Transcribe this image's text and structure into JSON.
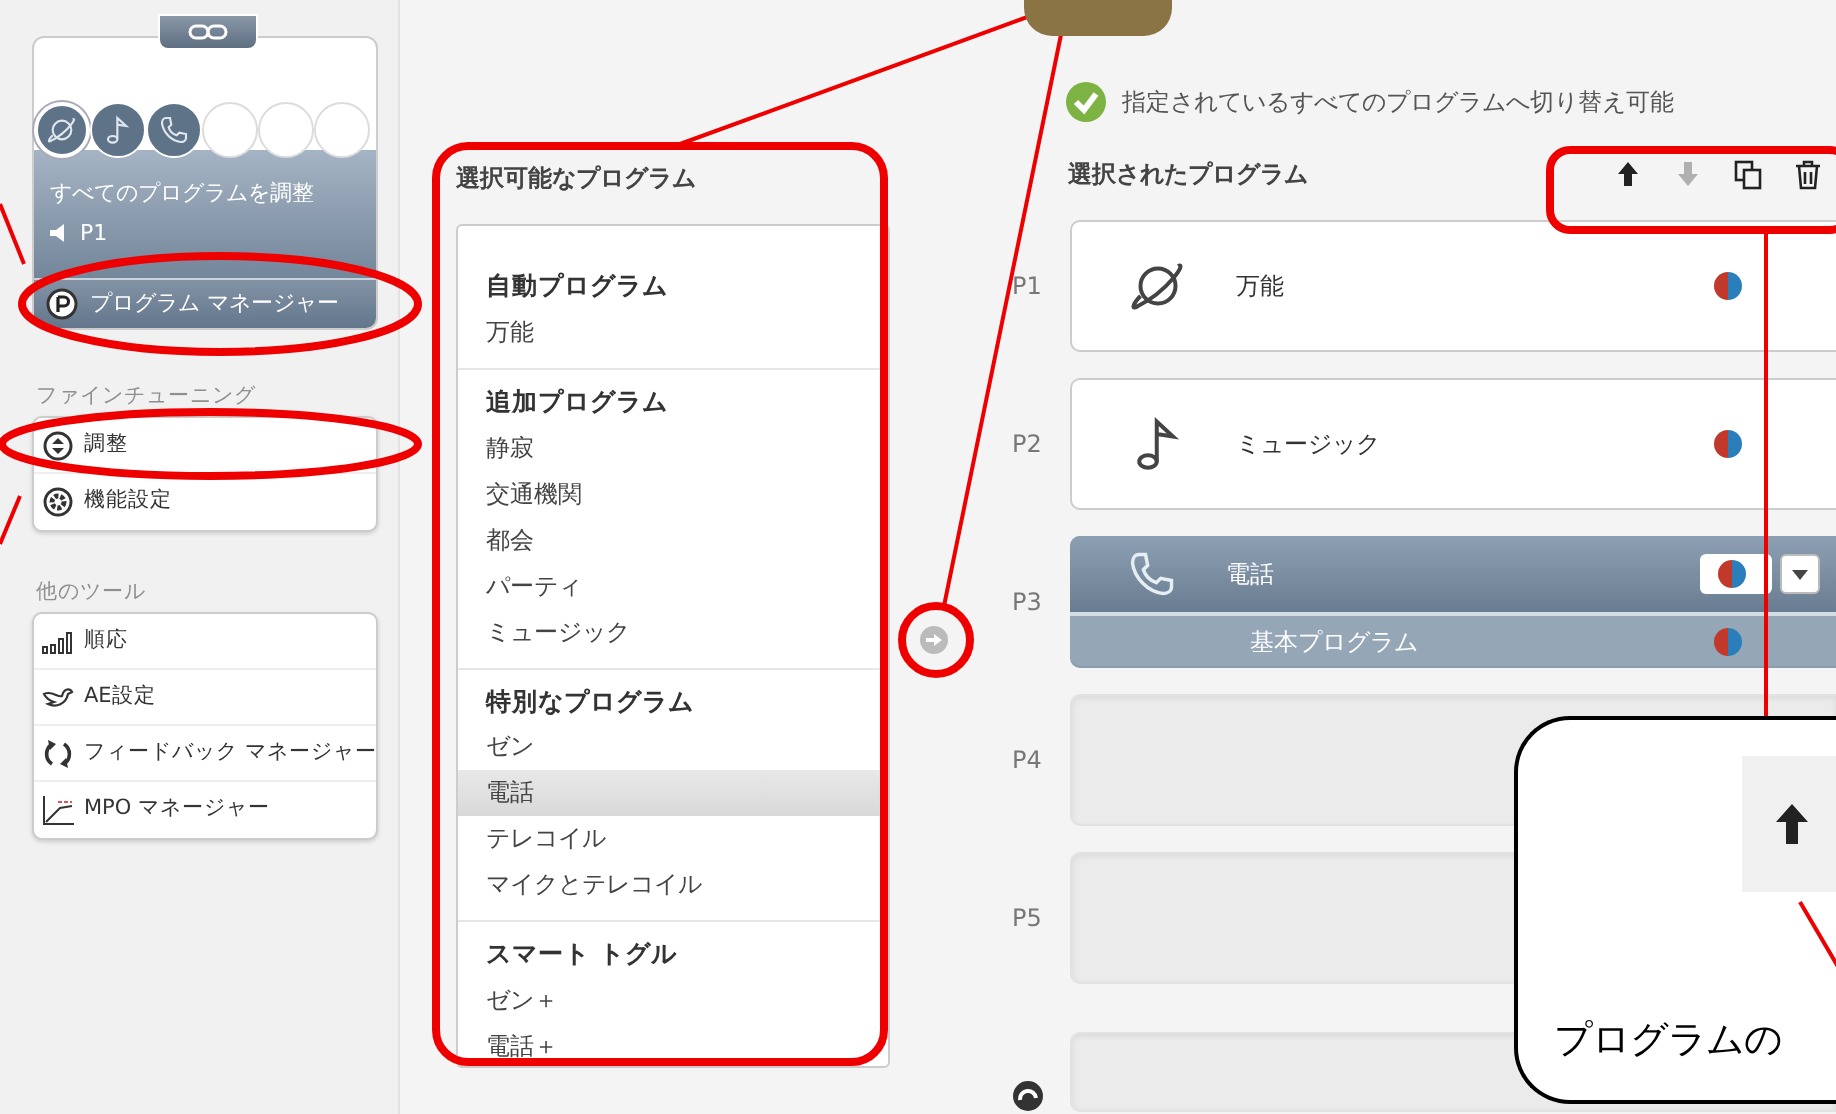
{
  "sidebar": {
    "program_slots": [
      {
        "kind": "planet",
        "selected": true
      },
      {
        "kind": "note",
        "selected": false
      },
      {
        "kind": "phone",
        "selected": false
      },
      {
        "kind": "empty",
        "selected": false
      },
      {
        "kind": "empty",
        "selected": false
      },
      {
        "kind": "empty",
        "selected": false
      }
    ],
    "current": {
      "title": "すべてのプログラムを調整",
      "program": "P1"
    },
    "nav": [
      {
        "label": "プログラム マネージャー",
        "kind": "programs",
        "selected": true
      }
    ],
    "sections": [
      {
        "title": "ファインチューニング",
        "items": [
          {
            "label": "調整",
            "kind": "adjust"
          },
          {
            "label": "機能設定",
            "kind": "gear"
          }
        ]
      },
      {
        "title": "他のツール",
        "items": [
          {
            "label": "順応",
            "kind": "bars"
          },
          {
            "label": "AE設定",
            "kind": "bird"
          },
          {
            "label": "フィードバック マネージャー",
            "kind": "cycle"
          },
          {
            "label": "MPO マネージャー",
            "kind": "curve"
          }
        ]
      }
    ]
  },
  "available": {
    "title": "選択可能なプログラム",
    "groups": [
      {
        "heading": "自動プログラム",
        "items": [
          {
            "label": "万能",
            "selected": false
          }
        ]
      },
      {
        "heading": "追加プログラム",
        "items": [
          {
            "label": "静寂",
            "selected": false
          },
          {
            "label": "交通機関",
            "selected": false
          },
          {
            "label": "都会",
            "selected": false
          },
          {
            "label": "パーティ",
            "selected": false
          },
          {
            "label": "ミュージック",
            "selected": false
          }
        ]
      },
      {
        "heading": "特別なプログラム",
        "items": [
          {
            "label": "ゼン",
            "selected": false
          },
          {
            "label": "電話",
            "selected": true
          },
          {
            "label": "テレコイル",
            "selected": false
          },
          {
            "label": "マイクとテレコイル",
            "selected": false
          }
        ]
      },
      {
        "heading": "スマート トグル",
        "items": [
          {
            "label": "ゼン＋",
            "selected": false
          },
          {
            "label": "電話＋",
            "selected": false
          }
        ]
      }
    ]
  },
  "status": {
    "text": "指定されているすべてのプログラムへ切り替え可能"
  },
  "selected_programs": {
    "title": "選択されたプログラム",
    "tools": [
      {
        "kind": "up",
        "disabled": false
      },
      {
        "kind": "down",
        "disabled": true
      },
      {
        "kind": "copy",
        "disabled": false
      },
      {
        "kind": "delete",
        "disabled": false
      }
    ],
    "slots": [
      {
        "label": "P1",
        "kind": "planet",
        "name": "万能",
        "selected": false
      },
      {
        "label": "P2",
        "kind": "note",
        "name": "ミュージック",
        "selected": false
      },
      {
        "label": "P3",
        "kind": "phone",
        "name": "電話",
        "selected": true,
        "sub": "基本プログラム"
      },
      {
        "label": "P4",
        "kind": "empty"
      },
      {
        "label": "P5",
        "kind": "empty"
      },
      {
        "kind": "loop"
      }
    ]
  },
  "annotation": {
    "callout_text": "プログラムの"
  }
}
